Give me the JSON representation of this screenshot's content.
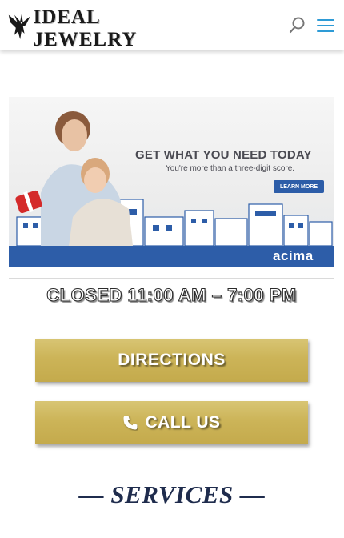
{
  "header": {
    "logo_text": "IDEAL JEWELRY",
    "icons": {
      "logo": "eagle-icon",
      "search": "search-icon",
      "menu": "hamburger-menu-icon"
    },
    "accent_color": "#2e9bd6"
  },
  "banner": {
    "headline": "GET WHAT YOU NEED TODAY",
    "subheadline": "You're more than a three-digit score.",
    "cta_label": "LEARN MORE",
    "brand": "acima",
    "brand_color": "#2d5da8"
  },
  "hours": {
    "text": "CLOSED  11:00 AM – 7:00 PM"
  },
  "buttons": {
    "directions_label": "DIRECTIONS",
    "call_label": "CALL US",
    "call_icon": "phone-icon",
    "gold_color": "#ccb458"
  },
  "services": {
    "heading": "— SERVICES —",
    "color": "#1f2c4d"
  }
}
